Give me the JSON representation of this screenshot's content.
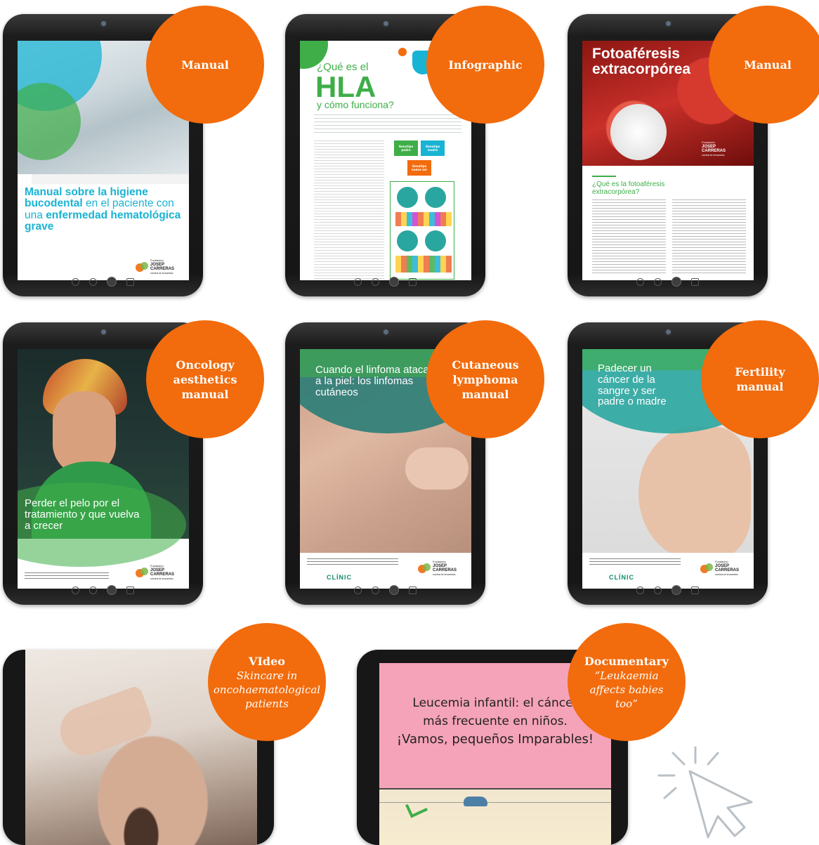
{
  "cards": [
    {
      "badge_title": "Manual",
      "cover_title_1": "Manual sobre la higiene",
      "cover_title_2": "bucodental",
      "cover_title_3": "en el paciente con una",
      "cover_title_4": "enfermedad",
      "cover_title_5": "hematológica grave"
    },
    {
      "badge_title": "Infographic",
      "cover_pre": "¿Qué es el",
      "cover_big": "HLA",
      "cover_post": "y cómo funciona?",
      "chip_1": "Genotipo padre",
      "chip_2": "Genotipo madre",
      "chip_3": "Genotipo nuevo ser"
    },
    {
      "badge_title": "Manual",
      "cover_title_1": "Fotoaféresis",
      "cover_title_2": "extracorpórea",
      "cover_question": "¿Qué es la fotoaféresis extracorpórea?"
    },
    {
      "badge_title_1": "Oncology",
      "badge_title_2": "aesthetics",
      "badge_title_3": "manual",
      "cover_title": "Perder el pelo por el tratamiento y que vuelva a crecer"
    },
    {
      "badge_title_1": "Cutaneous",
      "badge_title_2": "lymphoma",
      "badge_title_3": "manual",
      "cover_title": "Cuando el linfoma ataca a la piel: los linfomas cutáneos",
      "clinic": "CLÍNIC"
    },
    {
      "badge_title_1": "Fertility",
      "badge_title_2": "manual",
      "cover_title": "Padecer un cáncer de la sangre y ser padre o madre",
      "clinic": "CLÍNIC"
    },
    {
      "badge_title": "VIdeo",
      "badge_subtitle": "Skincare in oncohaematological patients"
    },
    {
      "badge_title": "Documentary",
      "badge_subtitle": "“Leukaemia affects babies too”",
      "screen_line_1": "Leucemia infantil: el cáncer",
      "screen_line_2": "más frecuente en niños.",
      "screen_line_3": "¡Vamos, pequeños Imparables!"
    }
  ],
  "logo": {
    "line_1": "Fundación",
    "line_2": "JOSEP",
    "line_3": "CARRERAS",
    "line_4": "contra la leucemia"
  },
  "colors": {
    "badge": "#f26b0c",
    "teal": "#2aa6a0",
    "green": "#3fae49",
    "cyan": "#19b3d3",
    "pink_screen": "#f5a3b8"
  },
  "icons": [
    "camera-icon",
    "back-icon",
    "search-icon",
    "home-icon",
    "cursor-click-icon",
    "cake-icon",
    "heart-shield-icon"
  ]
}
